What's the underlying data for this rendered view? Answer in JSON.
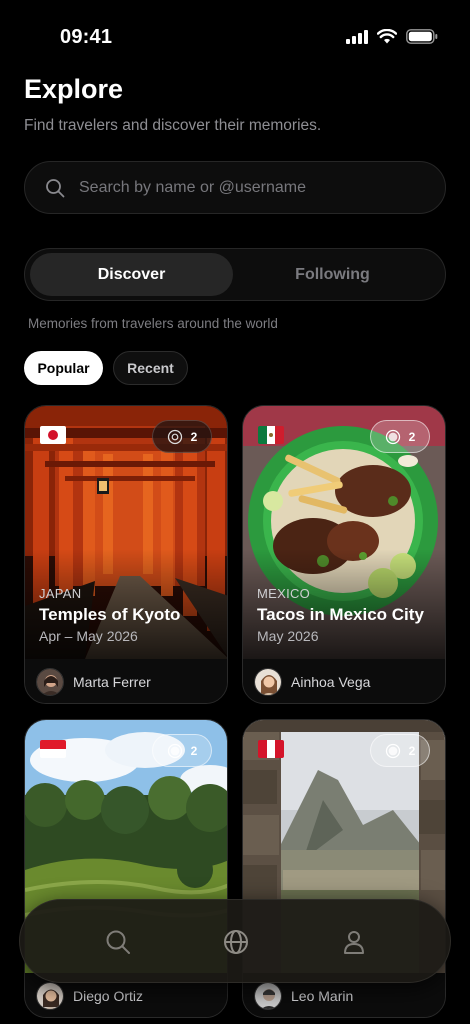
{
  "status_bar": {
    "time": "09:41"
  },
  "header": {
    "title": "Explore",
    "subtitle": "Find travelers and discover their memories."
  },
  "search": {
    "placeholder": "Search by name or @username",
    "value": ""
  },
  "tabs": [
    {
      "label": "Discover",
      "active": true
    },
    {
      "label": "Following",
      "active": false
    }
  ],
  "section_caption": "Memories from travelers around the world",
  "filters": [
    {
      "label": "Popular",
      "selected": true
    },
    {
      "label": "Recent",
      "selected": false
    }
  ],
  "cards": [
    {
      "country": "JAPAN",
      "title": "Temples of Kyoto",
      "dates": "Apr – May 2026",
      "count": "2",
      "author": "Marta Ferrer",
      "flag": "japan-flag"
    },
    {
      "country": "MEXICO",
      "title": "Tacos in Mexico City",
      "dates": "May 2026",
      "count": "2",
      "author": "Ainhoa Vega",
      "flag": "mexico-flag"
    },
    {
      "country": "",
      "title": "",
      "dates": "",
      "count": "2",
      "author": "Diego Ortiz",
      "flag": "indonesia-flag"
    },
    {
      "country": "",
      "title": "",
      "dates": "",
      "count": "2",
      "author": "Leo Marin",
      "flag": "peru-flag"
    }
  ],
  "tab_bar": {
    "items": [
      {
        "icon": "search-icon",
        "active": false
      },
      {
        "icon": "globe-icon",
        "active": true
      },
      {
        "icon": "profile-icon",
        "active": false
      }
    ]
  },
  "colors": {
    "background": "#000000",
    "accent": "#ffffff",
    "muted": "#8e8e93"
  }
}
